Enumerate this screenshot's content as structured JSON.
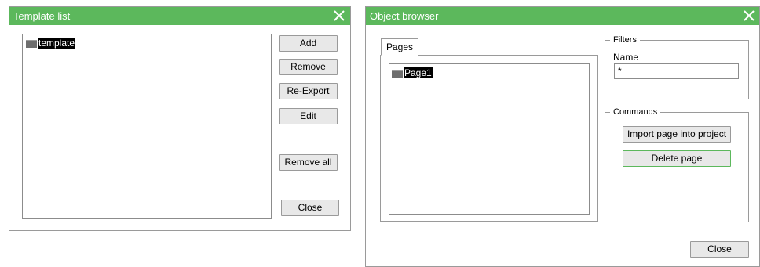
{
  "template_list": {
    "title": "Template list",
    "items": [
      {
        "label": "template"
      }
    ],
    "buttons": {
      "add": "Add",
      "remove": "Remove",
      "reexport": "Re-Export",
      "edit": "Edit",
      "remove_all": "Remove all",
      "close": "Close"
    }
  },
  "object_browser": {
    "title": "Object browser",
    "tabs": [
      {
        "label": "Pages",
        "active": true
      }
    ],
    "pages": [
      {
        "label": "Page1"
      }
    ],
    "filters": {
      "legend": "Filters",
      "name_label": "Name",
      "name_value": "*"
    },
    "commands": {
      "legend": "Commands",
      "import_label": "Import page into project",
      "delete_label": "Delete page"
    },
    "close_label": "Close"
  },
  "colors": {
    "titlebar": "#5cb85c",
    "selection": "#000000",
    "button_bg": "#e8e8e8"
  },
  "icons": {
    "close": "close-icon",
    "tree_item": "folder-icon"
  }
}
